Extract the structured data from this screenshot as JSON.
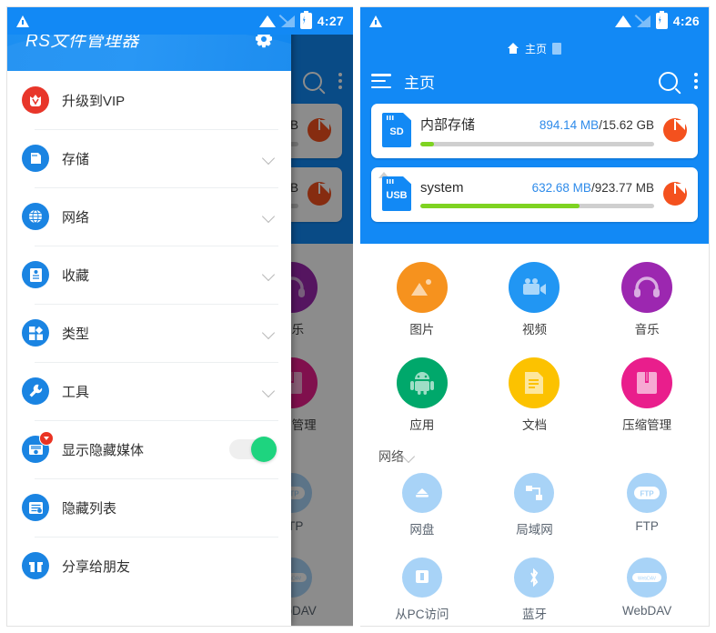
{
  "left_screen": {
    "statusbar": {
      "time": "4:27",
      "icons": [
        "warning-icon",
        "wifi-icon",
        "signal-off-icon",
        "battery-charging-icon"
      ]
    },
    "drawer": {
      "title": "RS文件管理器",
      "settings_icon": "gear-icon",
      "items": [
        {
          "label": "升级到VIP",
          "icon": "vip-crown-icon",
          "chevron": false,
          "toggle": null,
          "badge": false
        },
        {
          "label": "存储",
          "icon": "sdcard-icon",
          "chevron": true,
          "toggle": null,
          "badge": false
        },
        {
          "label": "网络",
          "icon": "globe-icon",
          "chevron": true,
          "toggle": null,
          "badge": false
        },
        {
          "label": "收藏",
          "icon": "bookmark-icon",
          "chevron": true,
          "toggle": null,
          "badge": false
        },
        {
          "label": "类型",
          "icon": "category-grid-icon",
          "chevron": true,
          "toggle": null,
          "badge": false
        },
        {
          "label": "工具",
          "icon": "wrench-icon",
          "chevron": true,
          "toggle": null,
          "badge": false
        },
        {
          "label": "显示隐藏媒体",
          "icon": "hidden-media-icon",
          "chevron": false,
          "toggle": "on",
          "badge": true
        },
        {
          "label": "隐藏列表",
          "icon": "hidden-list-icon",
          "chevron": false,
          "toggle": null,
          "badge": false
        },
        {
          "label": "分享给朋友",
          "icon": "gift-icon",
          "chevron": false,
          "toggle": null,
          "badge": false
        }
      ]
    }
  },
  "right_screen": {
    "statusbar": {
      "time": "4:26",
      "icons": [
        "warning-icon",
        "wifi-icon",
        "signal-off-icon",
        "battery-charging-icon"
      ]
    },
    "appbar": {
      "menu_icon": "hamburger-icon",
      "title": "主页",
      "search_icon": "search-icon",
      "overflow_icon": "kebab-menu-icon",
      "breadcrumb": {
        "home_label": "主页",
        "home_icon": "home-icon",
        "file_icon": "file-icon"
      }
    },
    "storage": [
      {
        "name": "内部存储",
        "badge": "SD",
        "used": "894.14 MB",
        "separator": "/",
        "total": "15.62 GB",
        "percent": 6,
        "pie_icon": "pie-chart-icon",
        "eject": false
      },
      {
        "name": "system",
        "badge": "USB",
        "used": "632.68 MB",
        "separator": "/",
        "total": "923.77 MB",
        "percent": 68,
        "pie_icon": "pie-chart-icon",
        "eject": true
      }
    ],
    "categories": [
      {
        "label": "图片",
        "icon": "image-icon",
        "color": "#f6921e"
      },
      {
        "label": "视频",
        "icon": "video-camera-icon",
        "color": "#2196f3"
      },
      {
        "label": "音乐",
        "icon": "headphones-icon",
        "color": "#9c27b0"
      },
      {
        "label": "应用",
        "icon": "android-icon",
        "color": "#00a86b"
      },
      {
        "label": "文档",
        "icon": "document-icon",
        "color": "#fcc200"
      },
      {
        "label": "压缩管理",
        "icon": "archive-book-icon",
        "color": "#e91e8c"
      }
    ],
    "network_section": {
      "title": "网络",
      "chevron_icon": "chevron-down-icon",
      "items": [
        {
          "label": "网盘",
          "icon": "cloud-drive-icon"
        },
        {
          "label": "局域网",
          "icon": "lan-icon"
        },
        {
          "label": "FTP",
          "icon": "ftp-icon"
        },
        {
          "label": "从PC访问",
          "icon": "pc-access-icon"
        },
        {
          "label": "蓝牙",
          "icon": "bluetooth-icon"
        },
        {
          "label": "WebDAV",
          "icon": "webdav-icon"
        }
      ]
    }
  },
  "colors": {
    "primary_blue": "#1289f5",
    "progress_green": "#7ed321",
    "pie_orange": "#f4511e",
    "toggle_green": "#1ed47f",
    "vip_red": "#e8362a",
    "used_text_blue": "#2e8bea"
  }
}
